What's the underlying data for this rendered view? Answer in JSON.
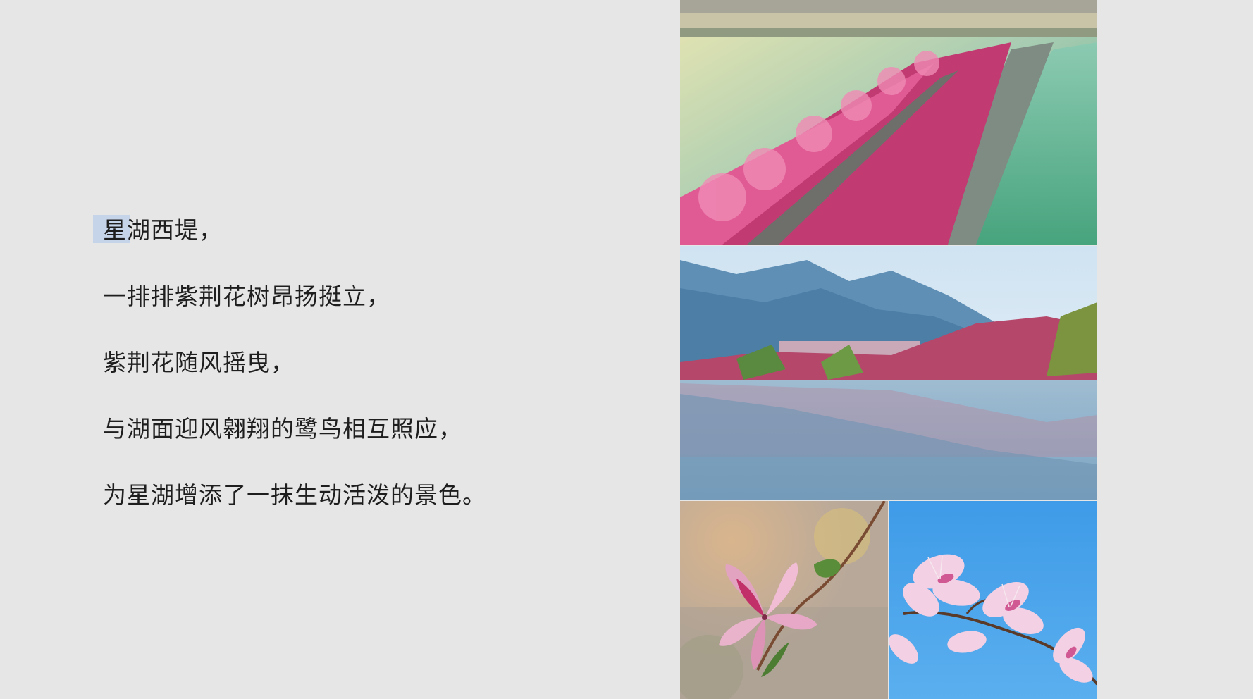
{
  "slide": {
    "poem_lines": [
      "星湖西堤，",
      "一排排紫荆花树昂扬挺立，",
      "紫荆花随风摇曳，",
      "与湖面迎风翱翔的鹭鸟相互照应，",
      "为星湖增添了一抹生动活泼的景色。"
    ]
  },
  "images": [
    {
      "name": "lakeside-promenade-photo",
      "icon": "photo-lake-promenade-with-bauhinia-trees"
    },
    {
      "name": "lake-reflection-photo",
      "icon": "photo-mountains-and-trees-reflected-in-lake"
    },
    {
      "name": "bauhinia-flower-bokeh-photo",
      "icon": "photo-pink-bauhinia-flower-close-up"
    },
    {
      "name": "bauhinia-flower-sky-photo",
      "icon": "photo-bauhinia-flowers-against-blue-sky"
    }
  ],
  "colors": {
    "background": "#e6e6e6",
    "text": "#1e1e1e",
    "selection_highlight": "#c5d4e9",
    "bauhinia_pink": "#d23a78",
    "lake_green": "#5fae8a",
    "sky_blue": "#3f9be8"
  }
}
